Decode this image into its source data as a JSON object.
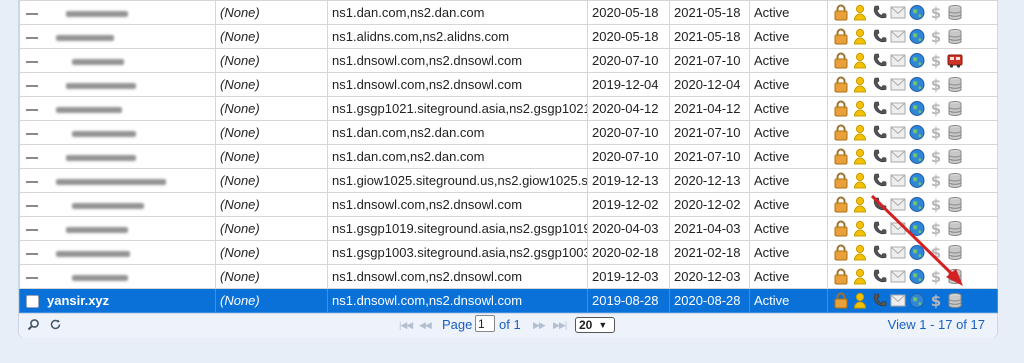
{
  "columns": [
    "",
    "",
    "",
    "",
    "",
    "",
    ""
  ],
  "rows": [
    {
      "domain": "",
      "blur_w": 62,
      "privacy": "(None)",
      "ns": "ns1.dan.com,ns2.dan.com",
      "registered": "2020-05-18",
      "expires": "2021-05-18",
      "status": "Active",
      "last_icon": "database-icon"
    },
    {
      "domain": "",
      "blur_w": 58,
      "privacy": "(None)",
      "ns": "ns1.alidns.com,ns2.alidns.com",
      "registered": "2020-05-18",
      "expires": "2021-05-18",
      "status": "Active",
      "last_icon": "database-icon"
    },
    {
      "domain": "",
      "blur_w": 52,
      "privacy": "(None)",
      "ns": "ns1.dnsowl.com,ns2.dnsowl.com",
      "registered": "2020-07-10",
      "expires": "2021-07-10",
      "status": "Active",
      "last_icon": "truck-icon"
    },
    {
      "domain": "",
      "blur_w": 70,
      "privacy": "(None)",
      "ns": "ns1.dnsowl.com,ns2.dnsowl.com",
      "registered": "2019-12-04",
      "expires": "2020-12-04",
      "status": "Active",
      "last_icon": "database-icon"
    },
    {
      "domain": "",
      "blur_w": 66,
      "privacy": "(None)",
      "ns": "ns1.gsgp1021.siteground.asia,ns2.gsgp1021.s",
      "registered": "2020-04-12",
      "expires": "2021-04-12",
      "status": "Active",
      "last_icon": "database-icon"
    },
    {
      "domain": "",
      "blur_w": 64,
      "privacy": "(None)",
      "ns": "ns1.dan.com,ns2.dan.com",
      "registered": "2020-07-10",
      "expires": "2021-07-10",
      "status": "Active",
      "last_icon": "database-icon"
    },
    {
      "domain": "",
      "blur_w": 70,
      "privacy": "(None)",
      "ns": "ns1.dan.com,ns2.dan.com",
      "registered": "2020-07-10",
      "expires": "2021-07-10",
      "status": "Active",
      "last_icon": "database-icon"
    },
    {
      "domain": "",
      "blur_w": 110,
      "privacy": "(None)",
      "ns": "ns1.giow1025.siteground.us,ns2.giow1025.site",
      "registered": "2019-12-13",
      "expires": "2020-12-13",
      "status": "Active",
      "last_icon": "database-icon"
    },
    {
      "domain": "",
      "blur_w": 72,
      "privacy": "(None)",
      "ns": "ns1.dnsowl.com,ns2.dnsowl.com",
      "registered": "2019-12-02",
      "expires": "2020-12-02",
      "status": "Active",
      "last_icon": "database-icon"
    },
    {
      "domain": "",
      "blur_w": 62,
      "privacy": "(None)",
      "ns": "ns1.gsgp1019.siteground.asia,ns2.gsgp1019.s",
      "registered": "2020-04-03",
      "expires": "2021-04-03",
      "status": "Active",
      "last_icon": "database-icon"
    },
    {
      "domain": "",
      "blur_w": 74,
      "privacy": "(None)",
      "ns": "ns1.gsgp1003.siteground.asia,ns2.gsgp1003.s",
      "registered": "2020-02-18",
      "expires": "2021-02-18",
      "status": "Active",
      "last_icon": "database-icon"
    },
    {
      "domain": "",
      "blur_w": 56,
      "privacy": "(None)",
      "ns": "ns1.dnsowl.com,ns2.dnsowl.com",
      "registered": "2019-12-03",
      "expires": "2020-12-03",
      "status": "Active",
      "last_icon": "database-icon"
    },
    {
      "domain": "yansir.xyz",
      "blur_w": 0,
      "privacy": "(None)",
      "ns": "ns1.dnsowl.com,ns2.dnsowl.com",
      "registered": "2019-08-28",
      "expires": "2020-08-28",
      "status": "Active",
      "last_icon": "database-icon",
      "selected": true
    }
  ],
  "row_icons": [
    "lock-icon",
    "user-icon",
    "phone-icon",
    "envelope-icon",
    "globe-icon",
    "dollar-icon"
  ],
  "colors": {
    "selected_bg": "#0a71d9",
    "lock": "#e8a13a",
    "user": "#f2c200",
    "globe": "#2f86d8",
    "truck": "#cc3322",
    "arrow": "#d42020"
  },
  "pager": {
    "page_label": "Page",
    "page_value": "1",
    "of_label": "of 1",
    "page_size": "20",
    "view_text": "View 1 - 17 of 17",
    "first_icon": "first-page-icon",
    "prev_icon": "prev-page-icon",
    "next_icon": "next-page-icon",
    "last_icon": "last-page-icon",
    "search_icon": "search-icon",
    "refresh_icon": "refresh-icon"
  }
}
